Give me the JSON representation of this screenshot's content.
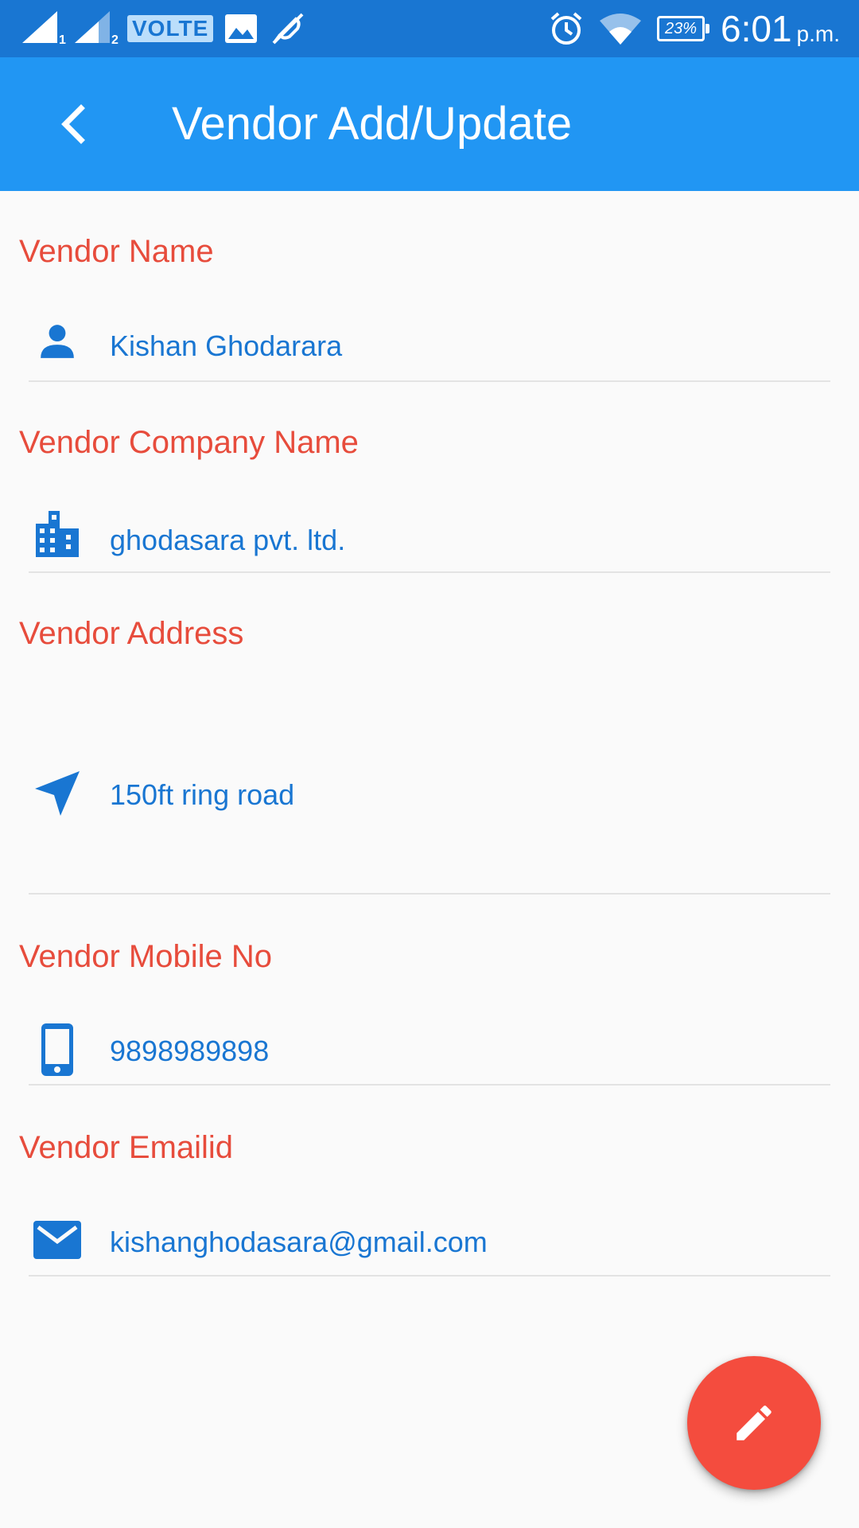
{
  "status_bar": {
    "sim1_index": "1",
    "sim2_index": "2",
    "volte_label": "VOLTE",
    "battery_percent": "23%",
    "time": "6:01",
    "ampm": "p.m."
  },
  "app_bar": {
    "title": "Vendor Add/Update",
    "back_icon": "chevron-left-icon"
  },
  "form": {
    "vendor_name": {
      "label": "Vendor Name",
      "value": "Kishan Ghodarara",
      "icon": "person-icon"
    },
    "company_name": {
      "label": "Vendor Company Name",
      "value": "ghodasara pvt. ltd.",
      "icon": "business-icon"
    },
    "address": {
      "label": "Vendor Address",
      "value": "150ft ring road",
      "icon": "navigation-icon"
    },
    "mobile": {
      "label": "Vendor Mobile No",
      "value": "9898989898",
      "icon": "phone-icon"
    },
    "email": {
      "label": "Vendor Emailid",
      "value": "kishanghodasara@gmail.com",
      "icon": "email-icon"
    }
  },
  "fab": {
    "icon": "edit-icon"
  },
  "colors": {
    "status_bar": "#1976d2",
    "app_bar": "#2196f3",
    "label": "#e74c3c",
    "value": "#1976d2",
    "fab": "#f44c3e",
    "background": "#fafafa"
  }
}
